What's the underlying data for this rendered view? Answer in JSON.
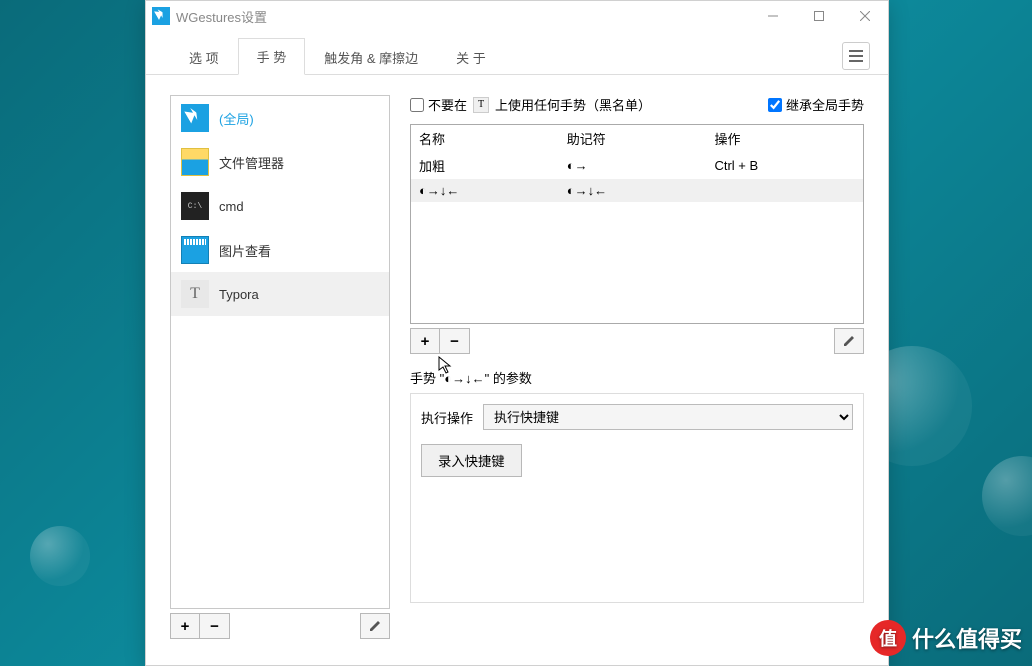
{
  "window": {
    "title": "WGestures设置"
  },
  "tabs": [
    {
      "label": "选 项",
      "active": false
    },
    {
      "label": "手 势",
      "active": true
    },
    {
      "label": "触发角 & 摩擦边",
      "active": false
    },
    {
      "label": "关 于",
      "active": false
    }
  ],
  "apps": [
    {
      "label": "(全局)",
      "selected": false,
      "global": true
    },
    {
      "label": "文件管理器",
      "selected": false
    },
    {
      "label": "cmd",
      "selected": false
    },
    {
      "label": "图片查看",
      "selected": false
    },
    {
      "label": "Typora",
      "selected": true
    }
  ],
  "checkboxes": {
    "blacklist_pre": "不要在",
    "blacklist_post": "上使用任何手势（黑名单）",
    "inherit": "继承全局手势"
  },
  "gesture_table": {
    "headers": {
      "name": "名称",
      "mnemonic": "助记符",
      "action": "操作"
    },
    "rows": [
      {
        "name": "加粗",
        "mnemonic": "◐→",
        "action": "Ctrl + B",
        "selected": false
      },
      {
        "name": "◐→↓←",
        "mnemonic": "◐→↓←",
        "action": "",
        "selected": true
      }
    ]
  },
  "params": {
    "title_prefix": "手势 \"",
    "title_gesture": "◐→↓←",
    "title_suffix": "\" 的参数",
    "exec_label": "执行操作",
    "exec_value": "执行快捷键",
    "record_btn": "录入快捷键"
  },
  "buttons": {
    "add": "+",
    "remove": "−"
  },
  "watermark": "什么值得买"
}
